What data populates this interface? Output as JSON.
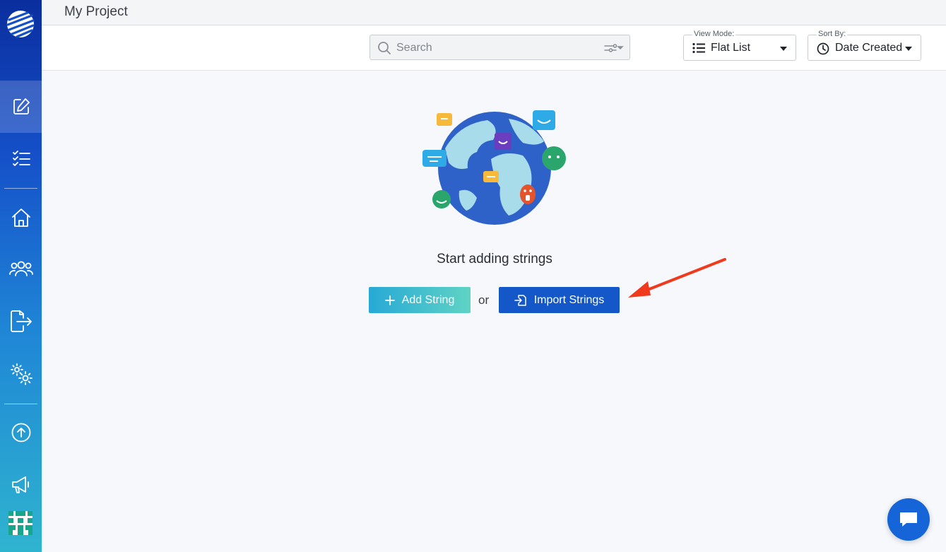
{
  "app": {
    "project_title": "My Project"
  },
  "sidebar": {
    "items": [
      {
        "icon": "edit-icon",
        "active": true
      },
      {
        "icon": "checklist-icon"
      },
      {
        "icon": "home-icon"
      },
      {
        "icon": "team-icon"
      },
      {
        "icon": "export-icon"
      },
      {
        "icon": "settings-icon"
      },
      {
        "icon": "upload-icon"
      },
      {
        "icon": "megaphone-icon"
      },
      {
        "icon": "avatar-icon"
      }
    ]
  },
  "toolbar": {
    "search": {
      "placeholder": "Search"
    },
    "view_mode": {
      "caption": "View Mode:",
      "value": "Flat List"
    },
    "sort_by": {
      "caption": "Sort By:",
      "value": "Date Created"
    }
  },
  "empty_state": {
    "title": "Start adding strings",
    "add_label": "Add String",
    "or_label": "or",
    "import_label": "Import Strings"
  },
  "colors": {
    "sidebar_top": "#0a2e9e",
    "sidebar_bottom": "#2fb4cf",
    "import_button": "#1457c9",
    "add_button_start": "#27a9d6",
    "add_button_end": "#5fd3c4",
    "annotation_arrow": "#f03a1e",
    "chat_button": "#1565d8"
  }
}
